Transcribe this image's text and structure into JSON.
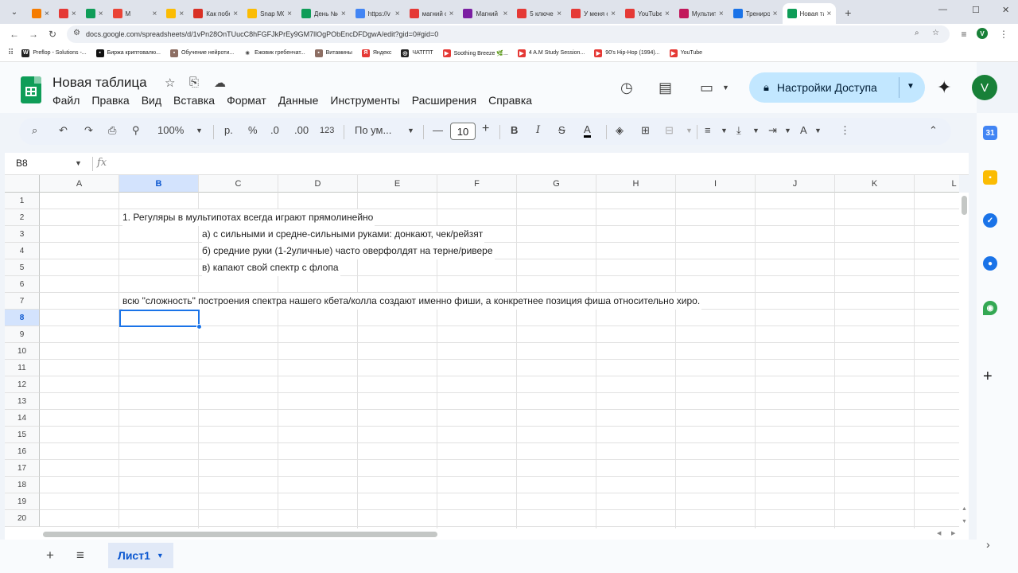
{
  "browser": {
    "tabs": [
      {
        "title": "",
        "color": "#f57c00"
      },
      {
        "title": "",
        "color": "#e53935"
      },
      {
        "title": "",
        "color": "#0f9d58"
      },
      {
        "title": "M",
        "color": "#ea4335"
      },
      {
        "title": "",
        "color": "#fbbc04"
      },
      {
        "title": "Как побе",
        "color": "#d93025"
      },
      {
        "title": "Snap MC",
        "color": "#fbbc04"
      },
      {
        "title": "День №4",
        "color": "#0f9d58"
      },
      {
        "title": "https://v",
        "color": "#4285f4"
      },
      {
        "title": "магний о",
        "color": "#e53935"
      },
      {
        "title": "Магний и",
        "color": "#7b1fa2"
      },
      {
        "title": "5 ключев",
        "color": "#e53935"
      },
      {
        "title": "У меня о",
        "color": "#e53935"
      },
      {
        "title": "YouTube",
        "color": "#e53935"
      },
      {
        "title": "Мультип",
        "color": "#c2185b"
      },
      {
        "title": "Трениро",
        "color": "#1a73e8"
      },
      {
        "title": "Новая та",
        "color": "#0f9d58"
      }
    ],
    "url": "docs.google.com/spreadsheets/d/1vPn28OnTUucC8hFGFJkPrEy9GM7llOgPObEncDFDgwA/edit?gid=0#gid=0",
    "profile_initial": "V",
    "bookmarks": [
      {
        "label": "Preflop - Solutions -...",
        "color": "#222222",
        "glyph": "W"
      },
      {
        "label": "Биржа криптовалю...",
        "color": "#111111",
        "glyph": "▪"
      },
      {
        "label": "Обучение нейроти...",
        "color": "#8d6e63",
        "glyph": "▪"
      },
      {
        "label": "Ежовик гребенчат...",
        "color": "#ffffff",
        "glyph": "✳"
      },
      {
        "label": "Витамины",
        "color": "#8d6e63",
        "glyph": "▪"
      },
      {
        "label": "Яндекс",
        "color": "#e53935",
        "glyph": "Я"
      },
      {
        "label": "ЧАТГПТ",
        "color": "#222222",
        "glyph": "◎"
      },
      {
        "label": "Soothing Breeze 🌿...",
        "color": "#e53935",
        "glyph": "▶"
      },
      {
        "label": "4 A.M Study Session...",
        "color": "#e53935",
        "glyph": "▶"
      },
      {
        "label": "90's Hip-Hop (1994)...",
        "color": "#e53935",
        "glyph": "▶"
      },
      {
        "label": "YouTube",
        "color": "#e53935",
        "glyph": "▶"
      }
    ]
  },
  "sheets": {
    "doc_title": "Новая таблица",
    "menu": [
      "Файл",
      "Правка",
      "Вид",
      "Вставка",
      "Формат",
      "Данные",
      "Инструменты",
      "Расширения",
      "Справка"
    ],
    "share_label": "Настройки Доступа",
    "user_initial": "V",
    "toolbar": {
      "zoom": "100%",
      "currency": "р.",
      "percent": "%",
      "dec_decrease": ".0",
      "dec_increase": ".00",
      "number_format": "123",
      "font": "По ум...",
      "font_size": "10"
    },
    "name_box": "B8",
    "fx_label": "fx",
    "columns": [
      "A",
      "B",
      "C",
      "D",
      "E",
      "F",
      "G",
      "H",
      "I",
      "J",
      "K",
      "L"
    ],
    "selected_column": "B",
    "rows": [
      "1",
      "2",
      "3",
      "4",
      "5",
      "6",
      "7",
      "8",
      "9",
      "10",
      "11",
      "12",
      "13",
      "14",
      "15",
      "16",
      "17",
      "18",
      "19",
      "20"
    ],
    "selected_row": "8",
    "cells": [
      {
        "col": 1,
        "row": 2,
        "text": "1. Регуляры в мультипотах всегда играют прямолинейно"
      },
      {
        "col": 2,
        "row": 3,
        "text": "а) с сильными и средне-сильными руками: донкают, чек/рейзят"
      },
      {
        "col": 2,
        "row": 4,
        "text": "б) средние руки (1-2уличные) часто оверфолдят на терне/ривере"
      },
      {
        "col": 2,
        "row": 5,
        "text": "в) капают свой спектр с флопа"
      },
      {
        "col": 1,
        "row": 7,
        "text": "всю \"сложность\" построения спектра нашего кбета/колла создают именно фиши, а конкретнее позиция фиша относительно хиро."
      }
    ],
    "sheet_tab": "Лист1"
  }
}
